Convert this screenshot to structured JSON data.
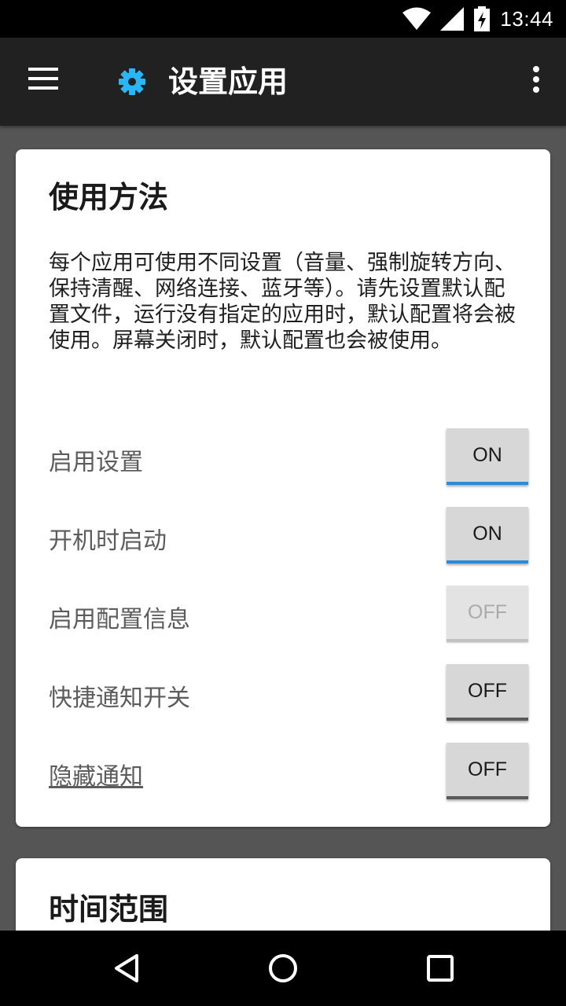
{
  "status_bar": {
    "time": "13:44"
  },
  "app_bar": {
    "title": "设置应用"
  },
  "usage_card": {
    "title": "使用方法",
    "description": "每个应用可使用不同设置（音量、强制旋转方向、保持清醒、网络连接、蓝牙等）。请先设置默认配置文件，运行没有指定的应用时，默认配置将会被使用。屏幕关闭时，默认配置也会被使用。",
    "settings": [
      {
        "label": "启用设置",
        "toggle": "ON"
      },
      {
        "label": "开机时启动",
        "toggle": "ON"
      },
      {
        "label": "启用配置信息",
        "toggle": "OFF"
      },
      {
        "label": "快捷通知开关",
        "toggle": "OFF"
      },
      {
        "label": "隐藏通知",
        "toggle": "OFF"
      }
    ]
  },
  "time_card": {
    "title": "时间范围"
  },
  "colors": {
    "accent": "#2b8bd6",
    "gear": "#29b6f6",
    "app_bar": "#212121",
    "background": "#555555"
  }
}
